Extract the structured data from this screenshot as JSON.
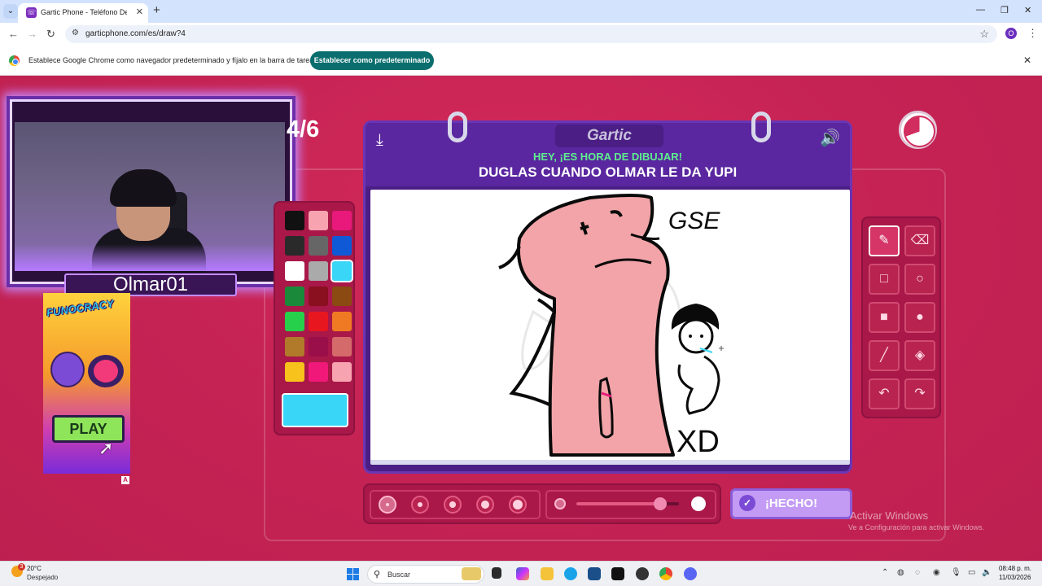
{
  "browser": {
    "tab_title": "Gartic Phone - Teléfono Descon",
    "url": "garticphone.com/es/draw?4",
    "profile_initial": "O",
    "infobar_text": "Establece Google Chrome como navegador predeterminado y fíjalo en la barra de tareas",
    "infobar_button": "Establecer como predeterminado"
  },
  "stream": {
    "streamer_name": "Olmar01",
    "round": "4/6",
    "ad_logo": "FUNOCRACY",
    "ad_button": "PLAY",
    "ad_badge": "A"
  },
  "game": {
    "brand": "Gartic",
    "subtitle": "HEY, ¡ES HORA DE DIBUJAR!",
    "title": "DUGLAS CUANDO OLMAR LE DA YUPI",
    "done_button": "¡HECHO!",
    "timer_remaining_fraction": 0.31,
    "opacity_level": 0.82,
    "selected_size_index": 0,
    "selected_color": "#39d6f7",
    "palette": [
      "#111111",
      "#f7a3b0",
      "#e8197a",
      "#2a2a2a",
      "#666666",
      "#1059d6",
      "#ffffff",
      "#aaaaaa",
      "#39d6f7",
      "#1a8a3a",
      "#8a0f1f",
      "#8a4a12",
      "#27d04a",
      "#e8161f",
      "#f07a24",
      "#b07a2a",
      "#9a0f4a",
      "#d46a6a",
      "#f8c21c",
      "#f0197a",
      "#f7a3b0"
    ],
    "tools": [
      "pencil-icon",
      "eraser-icon",
      "square-outline-icon",
      "circle-outline-icon",
      "square-filled-icon",
      "circle-filled-icon",
      "line-icon",
      "fill-icon",
      "undo-icon",
      "redo-icon"
    ],
    "drawing_text": [
      "GSE",
      "XD"
    ]
  },
  "os": {
    "weather_badge": "3",
    "temperature": "20°C",
    "condition": "Despejado",
    "search_placeholder": "Buscar",
    "time": "08:48 p. m.",
    "date": "11/03/2026",
    "watermark_1": "Activar Windows",
    "watermark_2": "Ve a Configuración para activar Windows."
  }
}
